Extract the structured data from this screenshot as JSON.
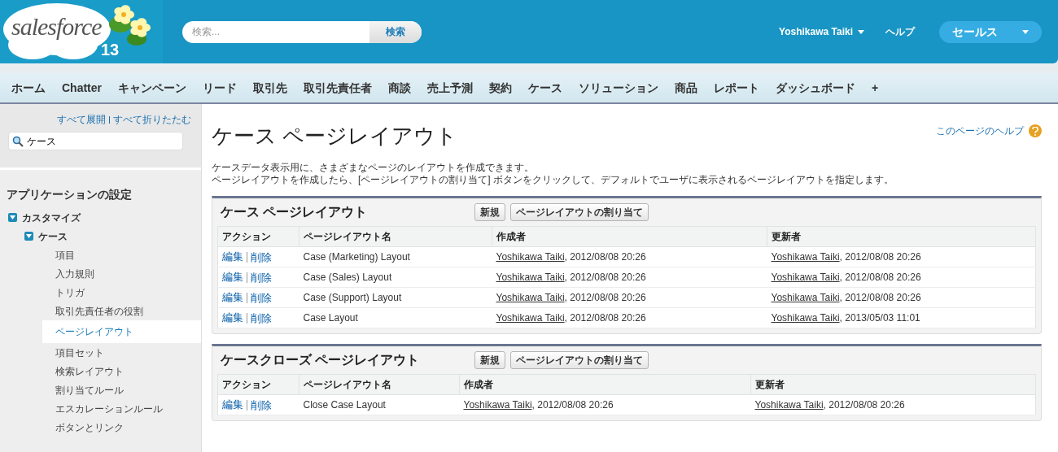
{
  "header": {
    "logo": {
      "text": "salesforce",
      "release": "13"
    },
    "search": {
      "placeholder": "検索...",
      "button": "検索"
    },
    "user_menu": "Yoshikawa Taiki",
    "help": "ヘルプ",
    "app_menu": "セールス"
  },
  "tabs": [
    {
      "label": "ホーム",
      "selected": false
    },
    {
      "label": "Chatter",
      "selected": false
    },
    {
      "label": "キャンペーン",
      "selected": false
    },
    {
      "label": "リード",
      "selected": false
    },
    {
      "label": "取引先",
      "selected": false
    },
    {
      "label": "取引先責任者",
      "selected": false
    },
    {
      "label": "商談",
      "selected": false
    },
    {
      "label": "売上予測",
      "selected": false
    },
    {
      "label": "契約",
      "selected": false
    },
    {
      "label": "ケース",
      "selected": false
    },
    {
      "label": "ソリューション",
      "selected": false
    },
    {
      "label": "商品",
      "selected": false
    },
    {
      "label": "レポート",
      "selected": false
    },
    {
      "label": "ダッシュボード",
      "selected": false
    },
    {
      "label": "+",
      "selected": false
    }
  ],
  "sidebar": {
    "expand_all": "すべて展開",
    "collapse_all": "すべて折りたたむ",
    "search_value": "ケース",
    "section_title": "アプリケーションの設定",
    "tree": [
      {
        "label": "カスタマイズ",
        "expanded": true,
        "selected": false,
        "children": [
          {
            "label": "ケース",
            "expanded": true,
            "selected": false,
            "children": [
              {
                "label": "項目",
                "selected": false
              },
              {
                "label": "入力規則",
                "selected": false
              },
              {
                "label": "トリガ",
                "selected": false
              },
              {
                "label": "取引先責任者の役割",
                "selected": false
              },
              {
                "label": "ページレイアウト",
                "selected": true
              },
              {
                "label": "項目セット",
                "selected": false
              },
              {
                "label": "検索レイアウト",
                "selected": false
              },
              {
                "label": "割り当てルール",
                "selected": false
              },
              {
                "label": "エスカレーションルール",
                "selected": false
              },
              {
                "label": "ボタンとリンク",
                "selected": false
              }
            ]
          }
        ]
      }
    ]
  },
  "main": {
    "title": "ケース ページレイアウト",
    "help_link": "このページのヘルプ",
    "description": [
      "ケースデータ表示用に、さまざまなページのレイアウトを作成できます。",
      "ページレイアウトを作成したら、[ページレイアウトの割り当て] ボタンをクリックして、デフォルトでユーザに表示されるページレイアウトを指定します。"
    ],
    "sections": [
      {
        "title": "ケース ページレイアウト",
        "buttons": [
          "新規",
          "ページレイアウトの割り当て"
        ],
        "columns": [
          "アクション",
          "ページレイアウト名",
          "作成者",
          "更新者"
        ],
        "rows": [
          {
            "edit": "編集",
            "delete": "削除",
            "name": "Case (Marketing) Layout",
            "created_by": "Yoshikawa Taiki",
            "created_at": ", 2012/08/08 20:26",
            "modified_by": "Yoshikawa Taiki",
            "modified_at": ", 2012/08/08 20:26"
          },
          {
            "edit": "編集",
            "delete": "削除",
            "name": "Case (Sales) Layout",
            "created_by": "Yoshikawa Taiki",
            "created_at": ", 2012/08/08 20:26",
            "modified_by": "Yoshikawa Taiki",
            "modified_at": ", 2012/08/08 20:26"
          },
          {
            "edit": "編集",
            "delete": "削除",
            "name": "Case (Support) Layout",
            "created_by": "Yoshikawa Taiki",
            "created_at": ", 2012/08/08 20:26",
            "modified_by": "Yoshikawa Taiki",
            "modified_at": ", 2012/08/08 20:26"
          },
          {
            "edit": "編集",
            "delete": "削除",
            "name": "Case Layout",
            "created_by": "Yoshikawa Taiki",
            "created_at": ", 2012/08/08 20:26",
            "modified_by": "Yoshikawa Taiki",
            "modified_at": ", 2013/05/03 11:01"
          }
        ]
      },
      {
        "title": "ケースクローズ ページレイアウト",
        "buttons": [
          "新規",
          "ページレイアウトの割り当て"
        ],
        "columns": [
          "アクション",
          "ページレイアウト名",
          "作成者",
          "更新者"
        ],
        "rows": [
          {
            "edit": "編集",
            "delete": "削除",
            "name": "Close Case Layout",
            "created_by": "Yoshikawa Taiki",
            "created_at": ", 2012/08/08 20:26",
            "modified_by": "Yoshikawa Taiki",
            "modified_at": ", 2012/08/08 20:26"
          }
        ]
      }
    ]
  }
}
